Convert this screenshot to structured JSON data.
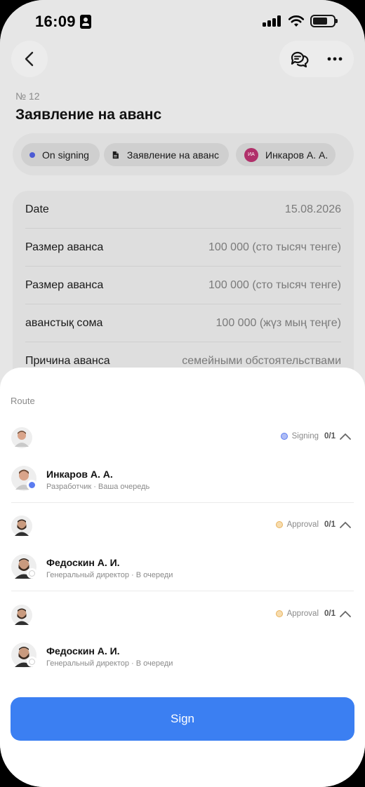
{
  "status_bar": {
    "time": "16:09"
  },
  "document": {
    "number": "№ 12",
    "title": "Заявление на аванс"
  },
  "tags": {
    "status": "On signing",
    "doc_type": "Заявление на аванс",
    "user_initials": "ИА",
    "user_name": "Инкаров А. А."
  },
  "details": [
    {
      "key": "Date",
      "value": "15.08.2026"
    },
    {
      "key": "Размер аванса",
      "value": "100 000 (сто тысяч тенге)"
    },
    {
      "key": "Размер аванса",
      "value": "100 000 (сто тысяч тенге)"
    },
    {
      "key": "авaнстық сома",
      "value": "100 000 (жүз мың теңге)"
    },
    {
      "key": "Причина аванса",
      "value": "семейными обстоятельствами"
    }
  ],
  "route": {
    "title": "Route",
    "steps": [
      {
        "status": "Signing",
        "count": "0/1",
        "status_color": "#5b7cf0",
        "person": {
          "name": "Инкаров А. А.",
          "subtitle": "Разработчик · Ваша очередь"
        }
      },
      {
        "status": "Approval",
        "count": "0/1",
        "status_color": "#f2c57a",
        "person": {
          "name": "Федоскин А. И.",
          "subtitle": "Генеральный директор · В очереди"
        }
      },
      {
        "status": "Approval",
        "count": "0/1",
        "status_color": "#f2c57a",
        "person": {
          "name": "Федоскин А. И.",
          "subtitle": "Генеральный директор · В очереди"
        }
      }
    ]
  },
  "actions": {
    "sign_label": "Sign"
  },
  "colors": {
    "accent": "#3b7ff2",
    "overlay": "#e6e6e6"
  }
}
